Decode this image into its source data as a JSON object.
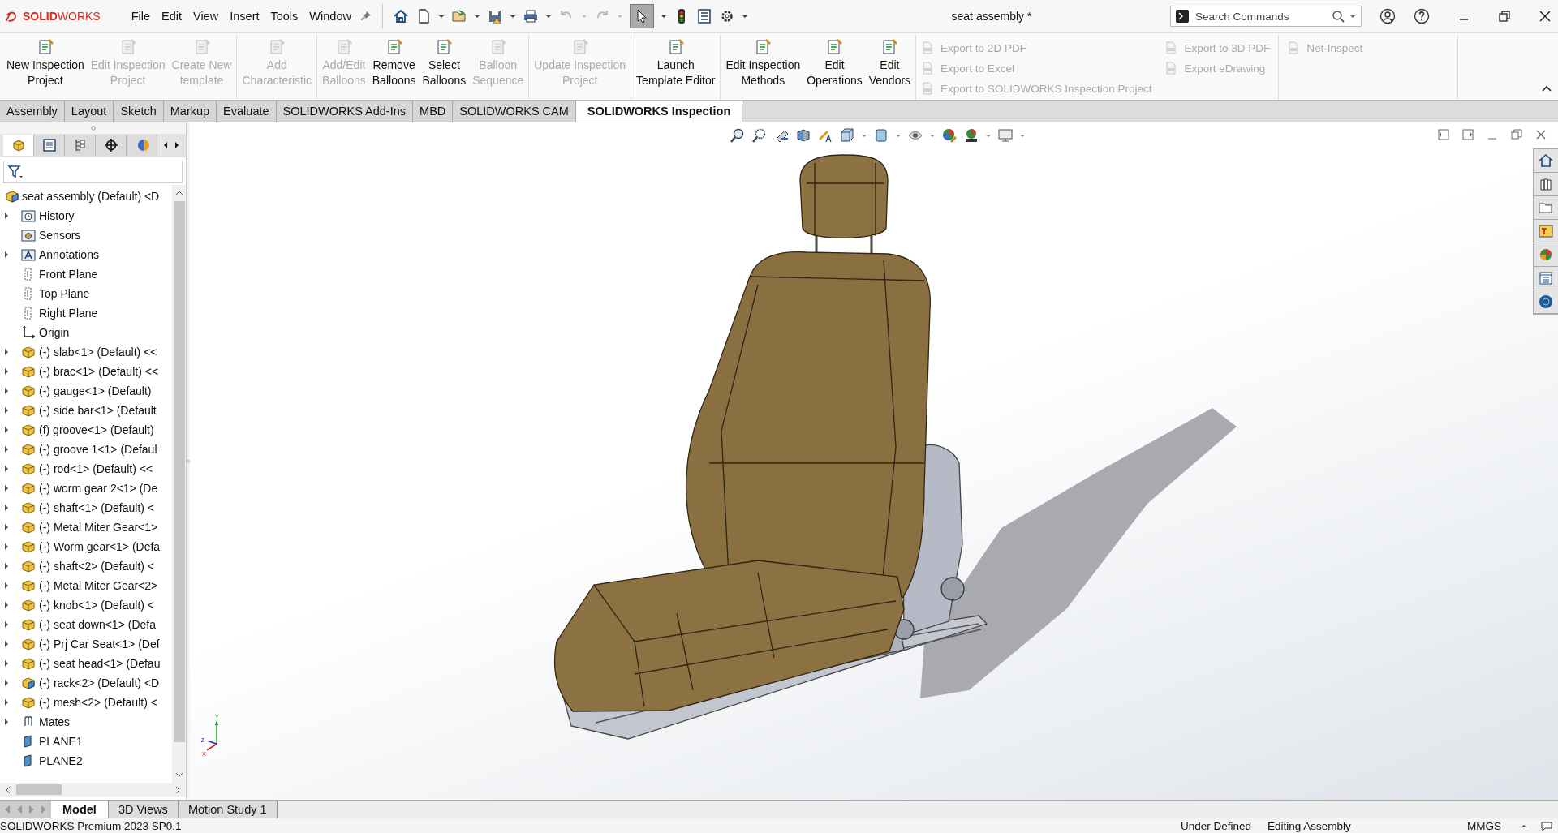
{
  "logo": "**SOLID**WORKS",
  "menu": [
    "File",
    "Edit",
    "View",
    "Insert",
    "Tools",
    "Window"
  ],
  "toolbar": {
    "select_active": true
  },
  "document_title": "seat assembly *",
  "search": {
    "placeholder": "Search Commands"
  },
  "ribbon": {
    "groups": [
      {
        "buttons": [
          {
            "lines": [
              "New Inspection",
              "Project"
            ],
            "disabled": false
          },
          {
            "lines": [
              "Edit Inspection",
              "Project"
            ],
            "disabled": true
          },
          {
            "lines": [
              "Create New",
              "template"
            ],
            "disabled": true
          }
        ]
      },
      {
        "buttons": [
          {
            "lines": [
              "Add",
              "Characteristic"
            ],
            "disabled": true
          }
        ]
      },
      {
        "buttons": [
          {
            "lines": [
              "Add/Edit",
              "Balloons"
            ],
            "disabled": true
          },
          {
            "lines": [
              "Remove",
              "Balloons"
            ],
            "disabled": false
          },
          {
            "lines": [
              "Select",
              "Balloons"
            ],
            "disabled": false
          },
          {
            "lines": [
              "Balloon",
              "Sequence"
            ],
            "disabled": true
          }
        ]
      },
      {
        "buttons": [
          {
            "lines": [
              "Update Inspection",
              "Project"
            ],
            "disabled": true
          }
        ]
      },
      {
        "buttons": [
          {
            "lines": [
              "Launch",
              "Template Editor"
            ],
            "disabled": false
          }
        ]
      },
      {
        "buttons": [
          {
            "lines": [
              "Edit Inspection",
              "Methods"
            ],
            "disabled": false
          },
          {
            "lines": [
              "Edit",
              "Operations"
            ],
            "disabled": false
          },
          {
            "lines": [
              "Edit",
              "Vendors"
            ],
            "disabled": false
          }
        ]
      }
    ],
    "export_columns": [
      {
        "items": [
          {
            "label": "Export to 2D PDF",
            "disabled": true
          },
          {
            "label": "Export to Excel",
            "disabled": true
          },
          {
            "label": "Export to SOLIDWORKS Inspection Project",
            "disabled": true
          }
        ]
      },
      {
        "items": [
          {
            "label": "Export to 3D PDF",
            "disabled": true
          },
          {
            "label": "Export eDrawing",
            "disabled": true
          }
        ]
      },
      {
        "items": [
          {
            "label": "Net-Inspect",
            "disabled": true
          }
        ]
      }
    ]
  },
  "command_tabs": [
    {
      "label": "Assembly",
      "selected": false
    },
    {
      "label": "Layout",
      "selected": false
    },
    {
      "label": "Sketch",
      "selected": false
    },
    {
      "label": "Markup",
      "selected": false
    },
    {
      "label": "Evaluate",
      "selected": false
    },
    {
      "label": "SOLIDWORKS Add-Ins",
      "selected": false
    },
    {
      "label": "MBD",
      "selected": false
    },
    {
      "label": "SOLIDWORKS CAM",
      "selected": false
    },
    {
      "label": "SOLIDWORKS Inspection",
      "selected": true
    }
  ],
  "manager_tabs": [
    {
      "selected": true
    },
    {
      "selected": false
    },
    {
      "selected": false
    },
    {
      "selected": false
    },
    {
      "selected": false
    }
  ],
  "tree": {
    "root": {
      "label": "seat assembly (Default) <D",
      "kind": "assembly"
    },
    "items": [
      {
        "label": "History",
        "kind": "history",
        "expandable": true
      },
      {
        "label": "Sensors",
        "kind": "sensors",
        "expandable": false
      },
      {
        "label": "Annotations",
        "kind": "annotations",
        "expandable": true
      },
      {
        "label": "Front Plane",
        "kind": "plane",
        "expandable": false
      },
      {
        "label": "Top Plane",
        "kind": "plane",
        "expandable": false
      },
      {
        "label": "Right Plane",
        "kind": "plane",
        "expandable": false
      },
      {
        "label": "Origin",
        "kind": "origin",
        "expandable": false
      },
      {
        "label": "(-) slab<1> (Default) <<",
        "kind": "part",
        "expandable": true
      },
      {
        "label": "(-) brac<1> (Default) <<",
        "kind": "part",
        "expandable": true
      },
      {
        "label": "(-) gauge<1> (Default)",
        "kind": "part",
        "expandable": true
      },
      {
        "label": "(-) side bar<1> (Default",
        "kind": "part",
        "expandable": true
      },
      {
        "label": "(f) groove<1> (Default)",
        "kind": "part",
        "expandable": true
      },
      {
        "label": "(-) groove 1<1> (Defaul",
        "kind": "part",
        "expandable": true
      },
      {
        "label": "(-) rod<1> (Default) <<",
        "kind": "part",
        "expandable": true
      },
      {
        "label": "(-) worm gear 2<1> (De",
        "kind": "part",
        "expandable": true
      },
      {
        "label": "(-) shaft<1> (Default) <",
        "kind": "part",
        "expandable": true
      },
      {
        "label": "(-) Metal Miter Gear<1>",
        "kind": "part",
        "expandable": true
      },
      {
        "label": "(-) Worm gear<1> (Defa",
        "kind": "part",
        "expandable": true
      },
      {
        "label": "(-) shaft<2> (Default) <",
        "kind": "part",
        "expandable": true
      },
      {
        "label": "(-) Metal Miter Gear<2>",
        "kind": "part",
        "expandable": true
      },
      {
        "label": "(-) knob<1> (Default) <",
        "kind": "part",
        "expandable": true
      },
      {
        "label": "(-) seat down<1> (Defa",
        "kind": "part",
        "expandable": true
      },
      {
        "label": "(-) Prj Car Seat<1> (Def",
        "kind": "part",
        "expandable": true
      },
      {
        "label": "(-) seat head<1> (Defau",
        "kind": "part",
        "expandable": true
      },
      {
        "label": "(-) rack<2> (Default) <D",
        "kind": "subassembly",
        "expandable": true
      },
      {
        "label": "(-) mesh<2> (Default) <",
        "kind": "part",
        "expandable": true
      },
      {
        "label": "Mates",
        "kind": "mates",
        "expandable": true
      },
      {
        "label": "PLANE1",
        "kind": "refplane",
        "expandable": false
      },
      {
        "label": "PLANE2",
        "kind": "refplane",
        "expandable": false
      }
    ]
  },
  "axes": {
    "x": "X",
    "y": "Y",
    "z": "Z"
  },
  "bottom_tabs": [
    {
      "label": "Model",
      "selected": true
    },
    {
      "label": "3D Views",
      "selected": false
    },
    {
      "label": "Motion Study 1",
      "selected": false
    }
  ],
  "status": {
    "product": "SOLIDWORKS Premium 2023 SP0.1",
    "definition": "Under Defined",
    "mode": "Editing Assembly",
    "units": "MMGS"
  }
}
